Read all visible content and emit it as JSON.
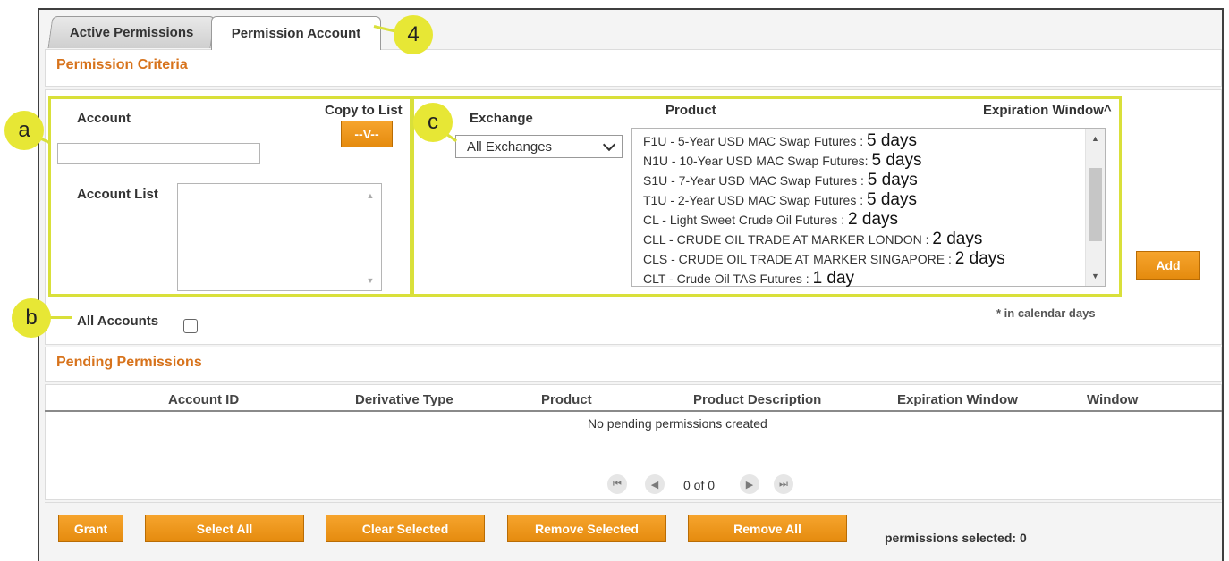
{
  "tabs": [
    {
      "label": "Active Permissions",
      "active": false
    },
    {
      "label": "Permission Account",
      "active": true
    }
  ],
  "callouts": {
    "tab": "4",
    "account": "a",
    "all_accounts": "b",
    "exchange": "c"
  },
  "criteria": {
    "title": "Permission Criteria",
    "account_label": "Account",
    "account_value": "",
    "copy_to_list_label": "Copy to List",
    "copy_button_label": "--V--",
    "account_list_label": "Account List",
    "all_accounts_label": "All Accounts",
    "all_accounts_checked": false,
    "exchange_label": "Exchange",
    "exchange_selected": "All Exchanges",
    "product_label": "Product",
    "expiration_label": "Expiration Window^",
    "products": [
      {
        "text": "F1U - 5-Year USD MAC Swap Futures :",
        "days": "5 days"
      },
      {
        "text": "N1U - 10-Year USD MAC Swap Futures:",
        "days": "5 days"
      },
      {
        "text": "S1U - 7-Year USD MAC Swap Futures :",
        "days": "5 days"
      },
      {
        "text": "T1U - 2-Year USD MAC Swap Futures :",
        "days": "5 days"
      },
      {
        "text": "CL - Light Sweet Crude Oil Futures :",
        "days": "2 days"
      },
      {
        "text": "CLL - CRUDE OIL TRADE AT MARKER LONDON :",
        "days": "2 days"
      },
      {
        "text": "CLS - CRUDE OIL TRADE AT MARKER SINGAPORE :",
        "days": "2 days"
      },
      {
        "text": "CLT - Crude Oil TAS Futures :",
        "days": "1 day"
      }
    ],
    "add_button_label": "Add",
    "calendar_note": "* in calendar days"
  },
  "pending": {
    "title": "Pending Permissions",
    "columns": [
      "Account ID",
      "Derivative Type",
      "Product",
      "Product Description",
      "Expiration Window",
      "Window"
    ],
    "empty_message": "No pending permissions created",
    "pager_text": "0 of 0"
  },
  "footer": {
    "buttons": [
      "Grant",
      "Select All",
      "Clear Selected",
      "Remove Selected",
      "Remove All"
    ],
    "selected_text": "permissions selected: 0"
  },
  "colors": {
    "accent": "#d7731c",
    "button": "#ee9a1c",
    "highlight": "#d9e03a"
  },
  "icons": [
    "first-page-icon",
    "prev-page-icon",
    "next-page-icon",
    "last-page-icon",
    "chevron-down-icon"
  ]
}
